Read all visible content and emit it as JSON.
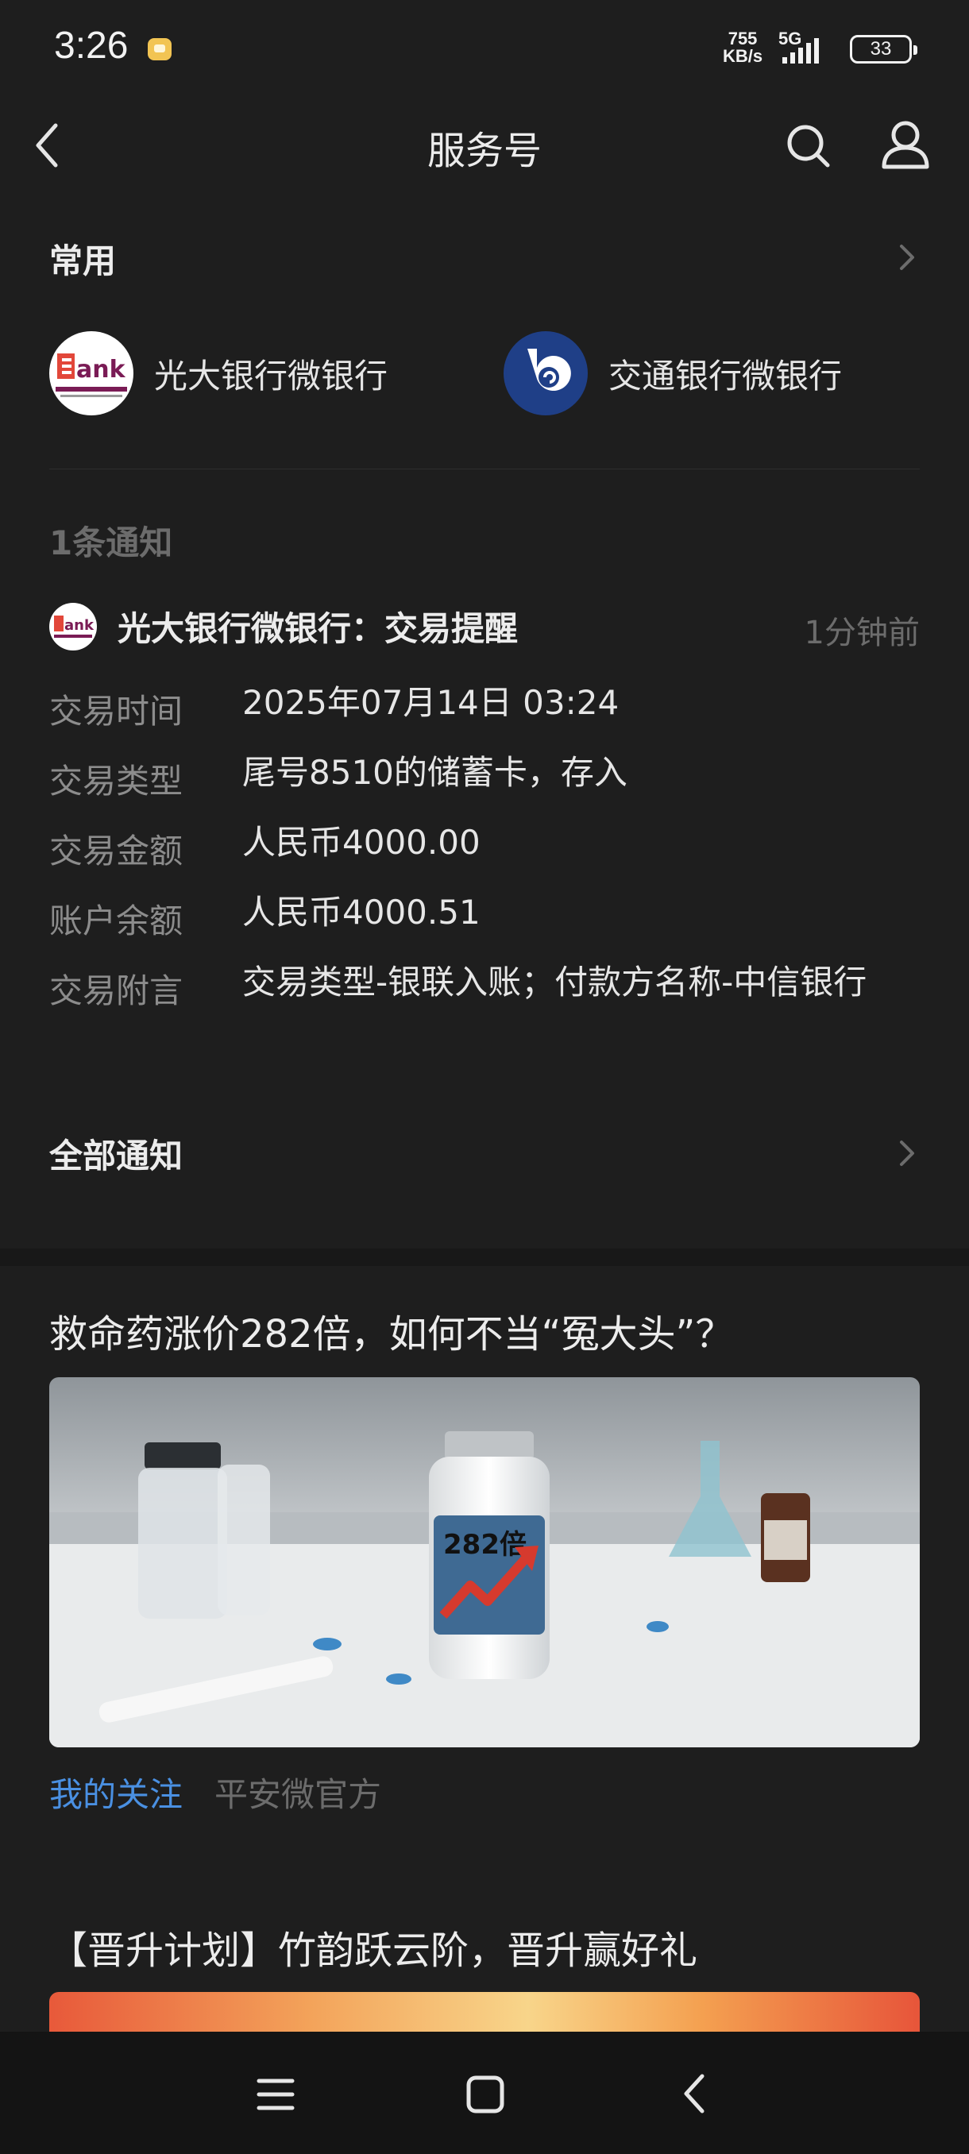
{
  "status_bar": {
    "time": "3:26",
    "net_speed_value": "755",
    "net_speed_unit": "KB/s",
    "network": "5G",
    "battery": "33"
  },
  "header": {
    "title": "服务号"
  },
  "common": {
    "heading": "常用",
    "items": [
      {
        "name": "光大银行微银行",
        "logo_text": "Bank"
      },
      {
        "name": "交通银行微银行"
      }
    ]
  },
  "notifications": {
    "count_label": "1条通知",
    "message": {
      "title": "光大银行微银行：交易提醒",
      "time": "1分钟前",
      "rows": [
        {
          "label": "交易时间",
          "value": "2025年07月14日 03:24"
        },
        {
          "label": "交易类型",
          "value": "尾号8510的储蓄卡，存入"
        },
        {
          "label": "交易金额",
          "value": "人民币4000.00"
        },
        {
          "label": "账户余额",
          "value": "人民币4000.51"
        },
        {
          "label": "交易附言",
          "value": "交易类型-银联入账；付款方名称-中信银行"
        }
      ]
    },
    "all_label": "全部通知"
  },
  "articles": [
    {
      "title": "救命药涨价282倍，如何不当“冤大头”？",
      "image_text": "282倍",
      "follow_tag": "我的关注",
      "source": "平安微官方"
    },
    {
      "title": "【晋升计划】竹韵跃云阶，晋升赢好礼"
    }
  ],
  "colors": {
    "background": "#1e1e1e",
    "link_blue": "#4a90e2",
    "muted": "#6c6c6c",
    "ceb_purple": "#7a1b55",
    "bocom_blue": "#1f3f87"
  }
}
